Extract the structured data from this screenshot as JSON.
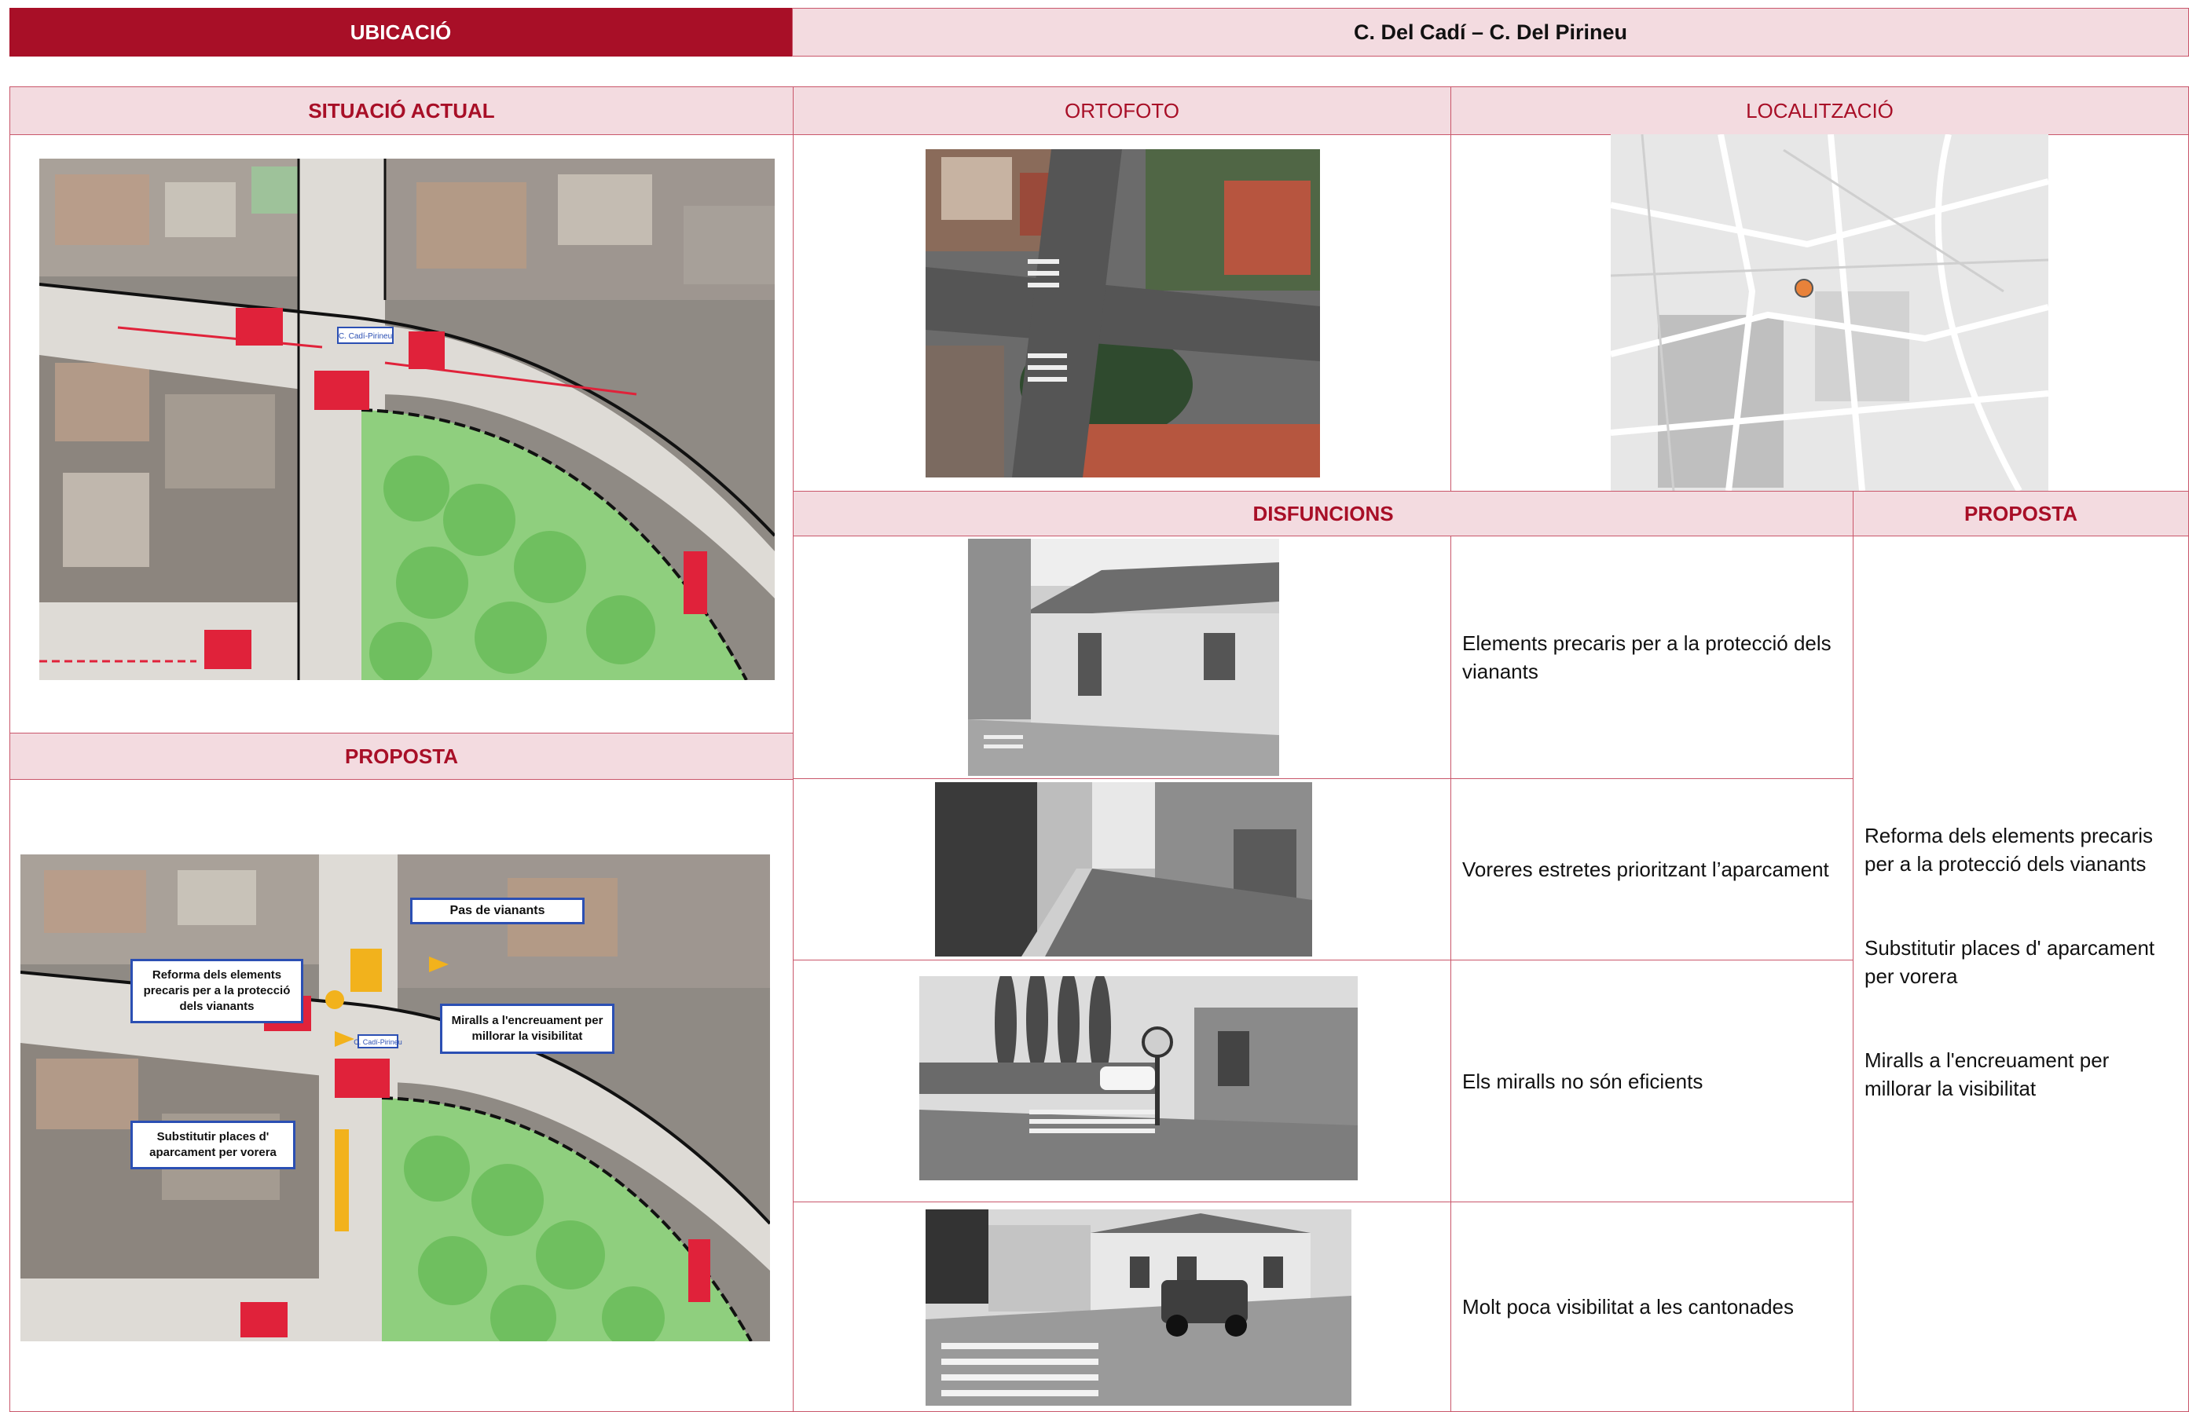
{
  "header": {
    "label": "UBICACIÓ",
    "location": "C. Del Cadí – C. Del Pirineu"
  },
  "sections": {
    "situacio_actual": "SITUACIÓ ACTUAL",
    "ortofoto": "ORTOFOTO",
    "localitzacio": "LOCALITZACIÓ",
    "proposta_left": "PROPOSTA",
    "disfuncions": "DISFUNCIONS",
    "proposta_right": "PROPOSTA"
  },
  "map_labels": {
    "street_tag": "C. Cadí-Pirineu",
    "pas_vianants": "Pas de vianants",
    "reforma": "Reforma dels elements precaris per a la protecció dels vianants",
    "miralls": "Miralls a l'encreuament per millorar la visibilitat",
    "substituir": "Substitutir places d' aparcament per vorera"
  },
  "disfuncions": [
    "Elements precaris per a la protecció dels vianants",
    "Voreres estretes prioritzant l’aparcament",
    "Els miralls no són eficients",
    "Molt poca visibilitat a les cantonades"
  ],
  "proposta_items": [
    "Reforma dels elements precaris per a la protecció dels vianants",
    "Substitutir places d' aparcament per vorera",
    "Miralls a l'encreuament per millorar la visibilitat"
  ],
  "colors": {
    "accent": "#a80f27",
    "header_bg": "#f3dbe0",
    "border": "#c9566a"
  }
}
